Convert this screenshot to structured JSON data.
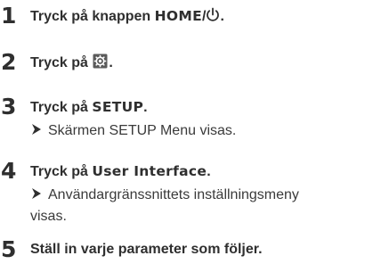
{
  "steps": [
    {
      "number": "1",
      "prefix": "Tryck på knappen ",
      "key": "HOME",
      "separator": "/",
      "suffix": ".",
      "icon": "power-icon"
    },
    {
      "number": "2",
      "prefix": "Tryck på ",
      "suffix": ".",
      "icon": "settings-icon"
    },
    {
      "number": "3",
      "prefix": "Tryck på ",
      "key": "SETUP",
      "suffix": ".",
      "result": "Skärmen SETUP Menu visas."
    },
    {
      "number": "4",
      "prefix": "Tryck på ",
      "key": "User Interface",
      "suffix": ".",
      "result_line1": "Användargränssnittets inställningsmeny",
      "result_line2": "visas."
    },
    {
      "number": "5",
      "text": "Ställ in varje parameter som följer."
    }
  ],
  "colors": {
    "text": "#2f2f2f",
    "icon_bg": "#5a5a5a"
  }
}
